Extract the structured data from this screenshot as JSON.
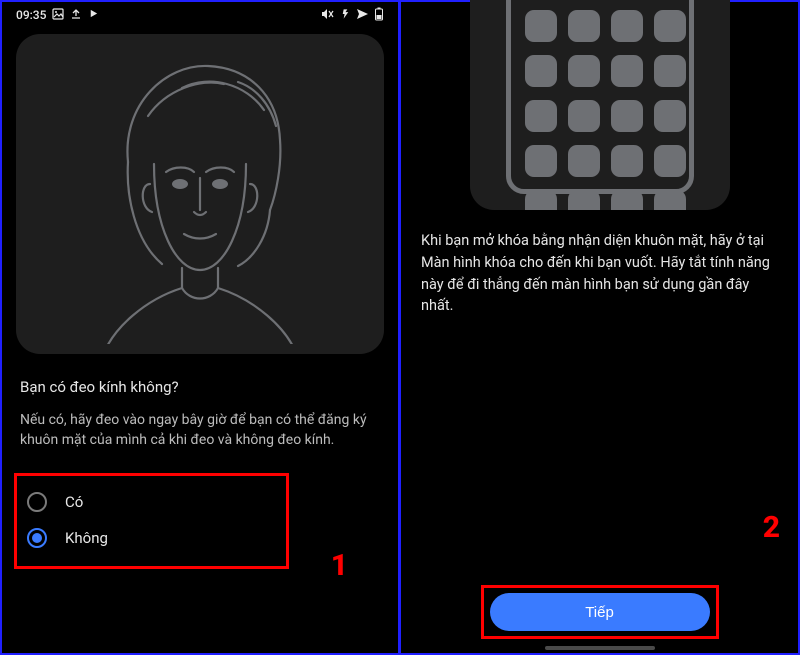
{
  "status_bar": {
    "time": "09:35",
    "icons_left": [
      "image-icon",
      "upload-icon",
      "play-icon"
    ],
    "icons_right": [
      "mute-icon",
      "vibrate-icon",
      "airplane-icon",
      "battery-icon"
    ]
  },
  "left": {
    "question_title": "Bạn có đeo kính không?",
    "question_desc": "Nếu có, hãy đeo vào ngay bây giờ để bạn có thể đăng ký khuôn mặt của mình cả khi đeo và không đeo kính.",
    "options": [
      {
        "label": "Có",
        "selected": false
      },
      {
        "label": "Không",
        "selected": true
      }
    ]
  },
  "right": {
    "info": "Khi bạn mở khóa bằng nhận diện khuôn mặt, hãy ở tại Màn hình khóa cho đến khi bạn vuốt. Hãy tắt tính năng này để đi thẳng đến màn hình bạn sử dụng gần đây nhất.",
    "primary_button": "Tiếp"
  },
  "annotations": {
    "one": "1",
    "two": "2"
  },
  "colors": {
    "accent": "#3a7bff",
    "highlight": "#ff0000",
    "border": "#2020ff"
  }
}
